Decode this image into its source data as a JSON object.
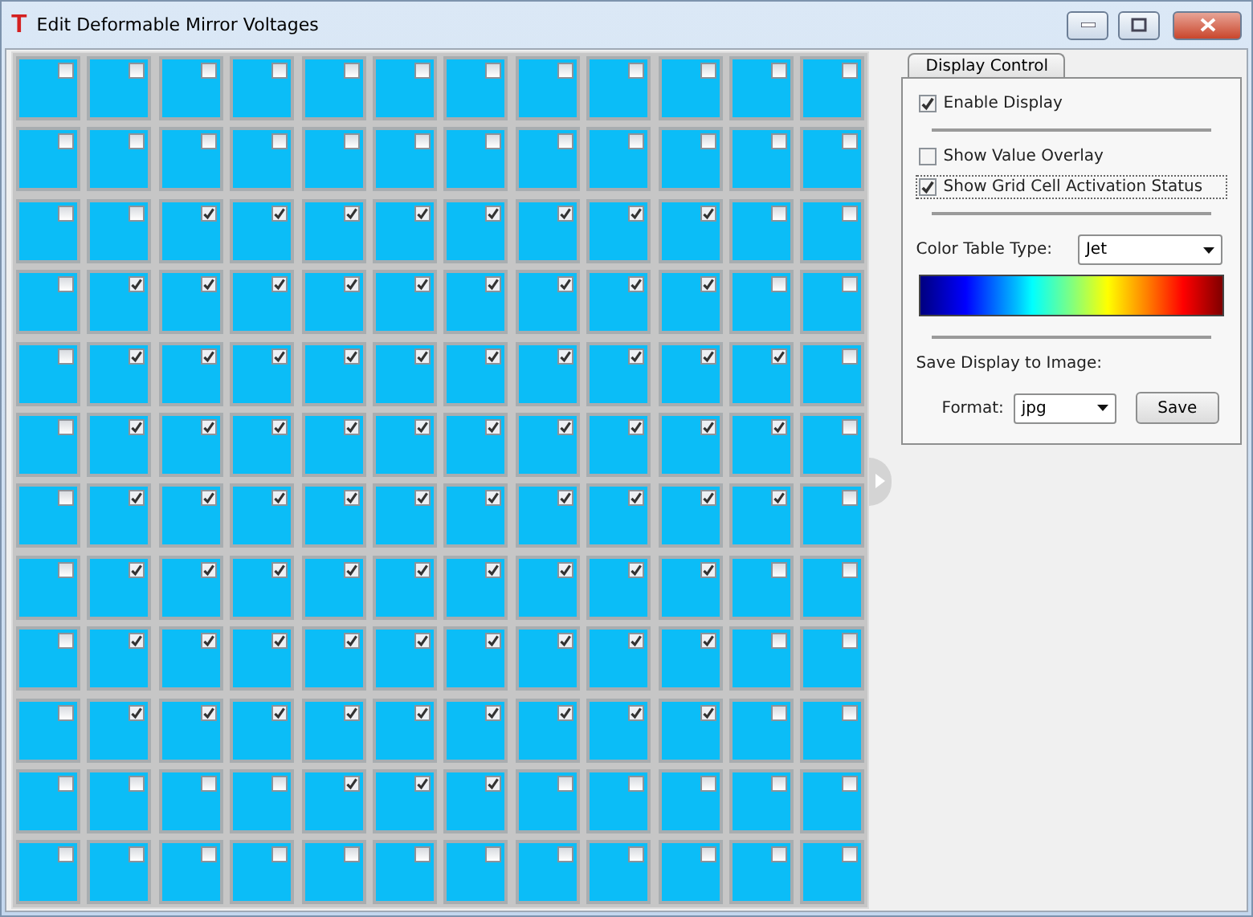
{
  "window": {
    "app_icon": "T",
    "title": "Edit Deformable Mirror Voltages"
  },
  "grid": {
    "rows": [
      [
        {
          "checked": false
        },
        {
          "checked": false
        },
        {
          "checked": false
        },
        {
          "checked": false
        },
        {
          "checked": false
        },
        {
          "checked": false
        },
        {
          "checked": false
        },
        {
          "checked": false
        },
        {
          "checked": false
        },
        {
          "checked": false
        },
        {
          "checked": false
        },
        {
          "checked": false
        }
      ],
      [
        {
          "checked": false
        },
        {
          "checked": false
        },
        {
          "checked": false
        },
        {
          "checked": false
        },
        {
          "checked": false
        },
        {
          "checked": false
        },
        {
          "checked": false
        },
        {
          "checked": false
        },
        {
          "checked": false
        },
        {
          "checked": false
        },
        {
          "checked": false
        },
        {
          "checked": false
        }
      ],
      [
        {
          "checked": false
        },
        {
          "checked": false
        },
        {
          "checked": true
        },
        {
          "checked": true
        },
        {
          "checked": true
        },
        {
          "checked": true
        },
        {
          "checked": true
        },
        {
          "checked": true
        },
        {
          "checked": true
        },
        {
          "checked": true
        },
        {
          "checked": false
        },
        {
          "checked": false
        }
      ],
      [
        {
          "checked": false
        },
        {
          "checked": true
        },
        {
          "checked": true
        },
        {
          "checked": true
        },
        {
          "checked": true
        },
        {
          "checked": true
        },
        {
          "checked": true
        },
        {
          "checked": true
        },
        {
          "checked": true
        },
        {
          "checked": true
        },
        {
          "checked": false
        },
        {
          "checked": false
        }
      ],
      [
        {
          "checked": false
        },
        {
          "checked": true
        },
        {
          "checked": true
        },
        {
          "checked": true
        },
        {
          "checked": true
        },
        {
          "checked": true
        },
        {
          "checked": true
        },
        {
          "checked": true
        },
        {
          "checked": true
        },
        {
          "checked": true
        },
        {
          "checked": true
        },
        {
          "checked": false
        }
      ],
      [
        {
          "checked": false
        },
        {
          "checked": true
        },
        {
          "checked": true
        },
        {
          "checked": true
        },
        {
          "checked": true
        },
        {
          "checked": true
        },
        {
          "checked": true
        },
        {
          "checked": true
        },
        {
          "checked": true
        },
        {
          "checked": true
        },
        {
          "checked": true
        },
        {
          "checked": false
        }
      ],
      [
        {
          "checked": false
        },
        {
          "checked": true
        },
        {
          "checked": true
        },
        {
          "checked": true
        },
        {
          "checked": true
        },
        {
          "checked": true
        },
        {
          "checked": true
        },
        {
          "checked": true
        },
        {
          "checked": true
        },
        {
          "checked": true
        },
        {
          "checked": true
        },
        {
          "checked": false
        }
      ],
      [
        {
          "checked": false
        },
        {
          "checked": true
        },
        {
          "checked": true
        },
        {
          "checked": true
        },
        {
          "checked": true
        },
        {
          "checked": true
        },
        {
          "checked": true
        },
        {
          "checked": true
        },
        {
          "checked": true
        },
        {
          "checked": true
        },
        {
          "checked": false
        },
        {
          "checked": false
        }
      ],
      [
        {
          "checked": false
        },
        {
          "checked": true
        },
        {
          "checked": true
        },
        {
          "checked": true
        },
        {
          "checked": true
        },
        {
          "checked": true
        },
        {
          "checked": true
        },
        {
          "checked": true
        },
        {
          "checked": true
        },
        {
          "checked": true
        },
        {
          "checked": false
        },
        {
          "checked": false
        }
      ],
      [
        {
          "checked": false
        },
        {
          "checked": true
        },
        {
          "checked": true
        },
        {
          "checked": true
        },
        {
          "checked": true
        },
        {
          "checked": true
        },
        {
          "checked": true
        },
        {
          "checked": true
        },
        {
          "checked": true
        },
        {
          "checked": true
        },
        {
          "checked": false
        },
        {
          "checked": false
        }
      ],
      [
        {
          "checked": false
        },
        {
          "checked": false
        },
        {
          "checked": false
        },
        {
          "checked": false
        },
        {
          "checked": true
        },
        {
          "checked": true
        },
        {
          "checked": true
        },
        {
          "checked": false
        },
        {
          "checked": false
        },
        {
          "checked": false
        },
        {
          "checked": false
        },
        {
          "checked": false
        }
      ],
      [
        {
          "checked": false
        },
        {
          "checked": false
        },
        {
          "checked": false
        },
        {
          "checked": false
        },
        {
          "checked": false
        },
        {
          "checked": false
        },
        {
          "checked": false
        },
        {
          "checked": false
        },
        {
          "checked": false
        },
        {
          "checked": false
        },
        {
          "checked": false
        },
        {
          "checked": false
        }
      ]
    ]
  },
  "panel": {
    "tab": {
      "label": "Display Control",
      "selected": true
    },
    "enable_display": {
      "label": "Enable Display",
      "checked": true
    },
    "options": [
      {
        "label": "Show Value Overlay",
        "checked": false,
        "focused": false
      },
      {
        "label": "Show Grid Cell Activation Status",
        "checked": true,
        "focused": true
      }
    ],
    "color_table": {
      "label": "Color Table Type:",
      "value": "Jet"
    },
    "save": {
      "heading": "Save Display to Image:",
      "format_label": "Format:",
      "format_value": "jpg",
      "button": "Save"
    }
  }
}
